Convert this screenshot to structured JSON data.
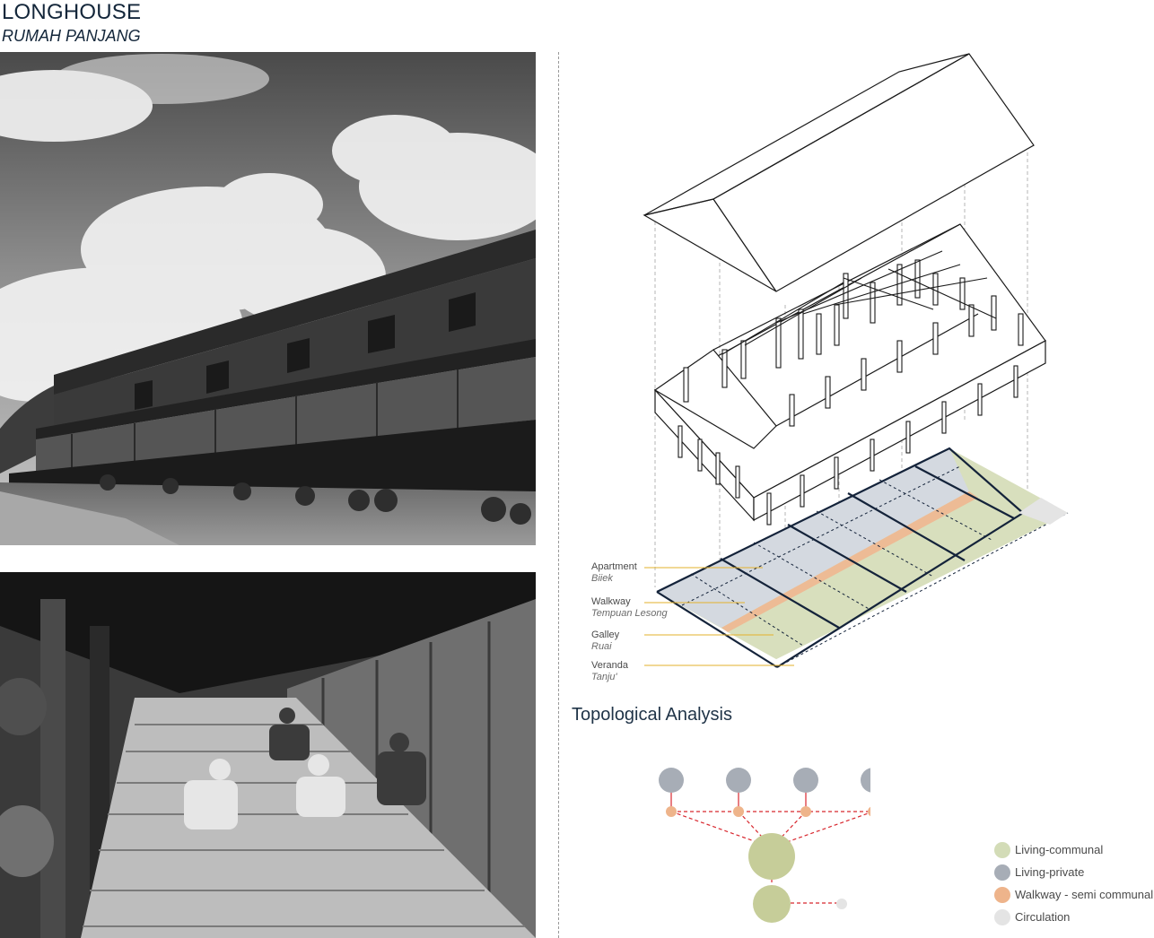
{
  "header": {
    "title": "LONGHOUSE",
    "subtitle": "RUMAH PANJANG"
  },
  "diagram": {
    "labels": [
      {
        "name": "Apartment",
        "local": "Biiek"
      },
      {
        "name": "Walkway",
        "local": "Tempuan Lesong"
      },
      {
        "name": "Galley",
        "local": "Ruai"
      },
      {
        "name": "Veranda",
        "local": "Tanju'"
      }
    ]
  },
  "topology": {
    "title": "Topological Analysis",
    "legend": [
      {
        "label": "Living-communal",
        "color": "#d3dcb7"
      },
      {
        "label": "Living-private",
        "color": "#a7adb6"
      },
      {
        "label": "Walkway - semi communal",
        "color": "#eeb48b"
      },
      {
        "label": "Circulation",
        "color": "#e4e4e4"
      }
    ]
  },
  "colors": {
    "veranda": "#d8dfbd",
    "walkway": "#edbb95",
    "apartment": "#d4d9e0",
    "outline": "#14233a",
    "leader": "#e3b12b",
    "edge": "#d8272e"
  }
}
